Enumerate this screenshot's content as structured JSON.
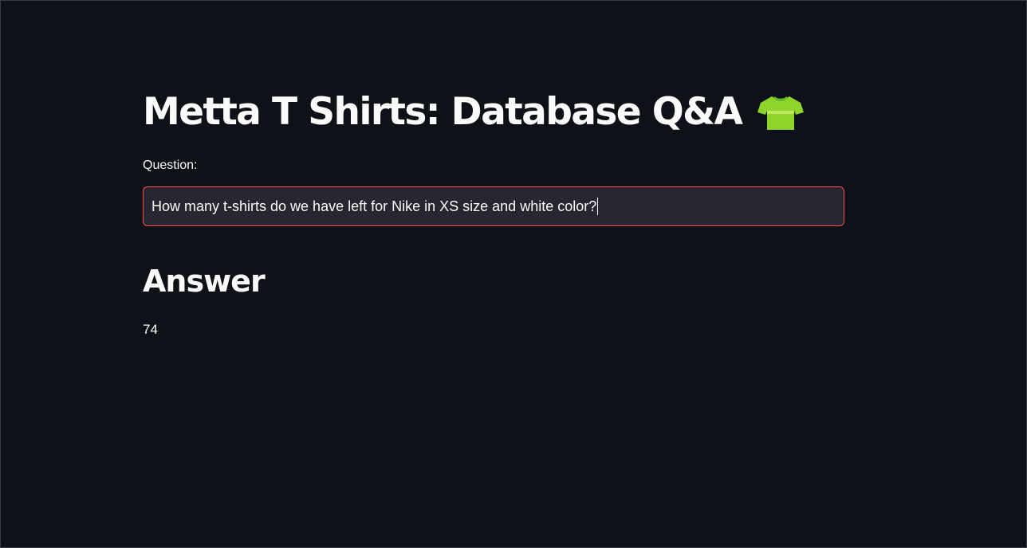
{
  "app": {
    "title": "Metta T Shirts: Database Q&A",
    "title_icon": "tshirt-icon"
  },
  "question": {
    "label": "Question:",
    "value": "How many t-shirts do we have left for Nike in XS size and white color?"
  },
  "answer": {
    "heading": "Answer",
    "value": "74"
  },
  "colors": {
    "background": "#0e1117",
    "input_background": "#262730",
    "input_focus_border": "#ff4b4b",
    "text": "#fafafa",
    "shirt_green": "#8fd42a"
  }
}
